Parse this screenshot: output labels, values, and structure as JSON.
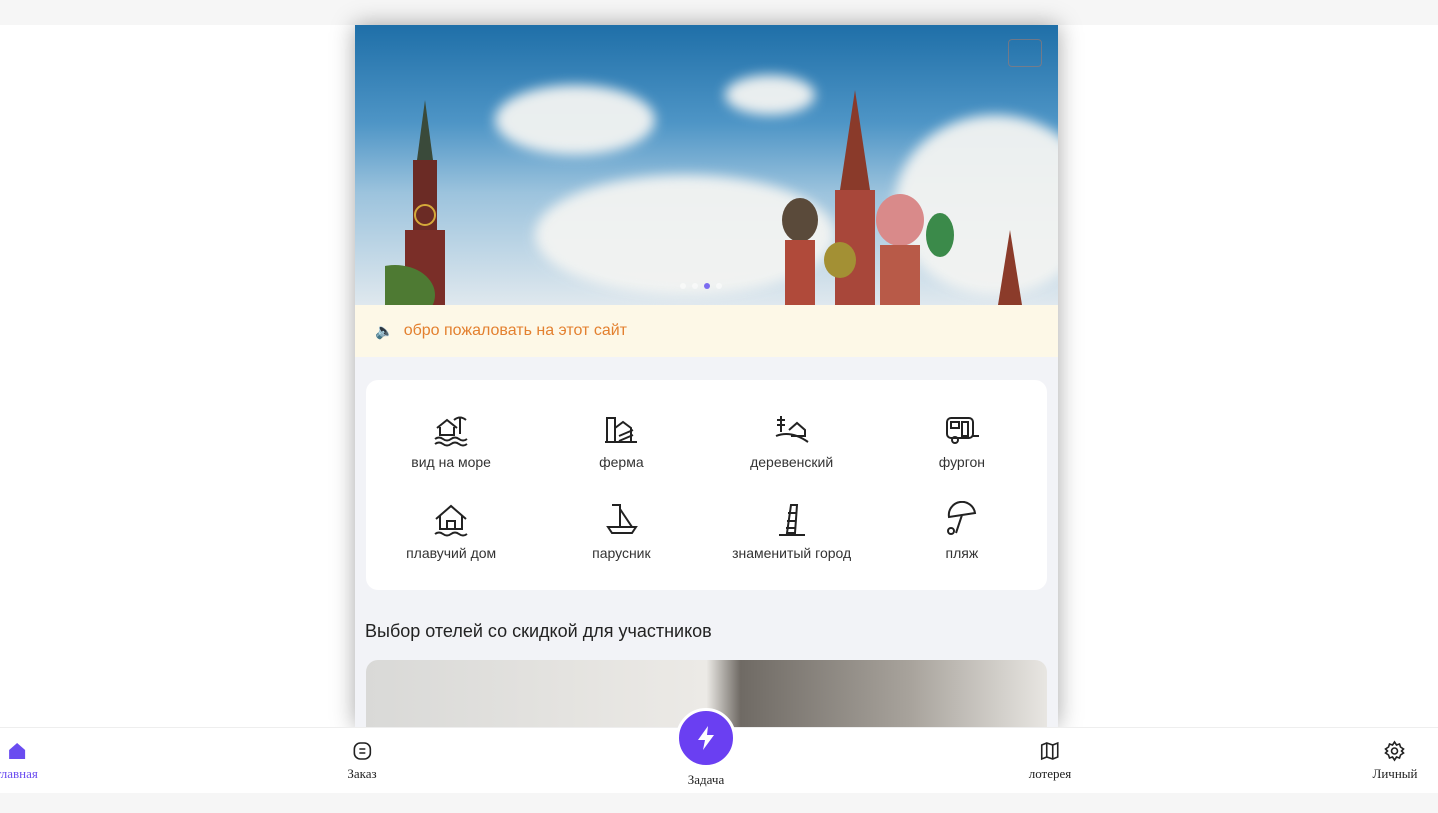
{
  "banner": {
    "slide_count": 4,
    "active_slide": 3
  },
  "notice": {
    "text": "обро пожаловать на этот сайт",
    "icon": "speaker-icon"
  },
  "categories": [
    {
      "label": "вид на море",
      "icon": "seaside-house-icon"
    },
    {
      "label": "ферма",
      "icon": "farm-icon"
    },
    {
      "label": "деревенский",
      "icon": "rural-icon"
    },
    {
      "label": "фургон",
      "icon": "caravan-icon"
    },
    {
      "label": "плавучий дом",
      "icon": "houseboat-icon"
    },
    {
      "label": "парусник",
      "icon": "sailboat-icon"
    },
    {
      "label": "знаменитый город",
      "icon": "famous-city-icon"
    },
    {
      "label": "пляж",
      "icon": "beach-umbrella-icon"
    }
  ],
  "section": {
    "title": "Выбор отелей со скидкой для участников"
  },
  "nav": {
    "home": "главная",
    "order": "Заказ",
    "task": "Задача",
    "lottery": "лотерея",
    "profile": "Личный"
  },
  "colors": {
    "accent": "#6a3ff2",
    "notice": "#e3802f"
  }
}
